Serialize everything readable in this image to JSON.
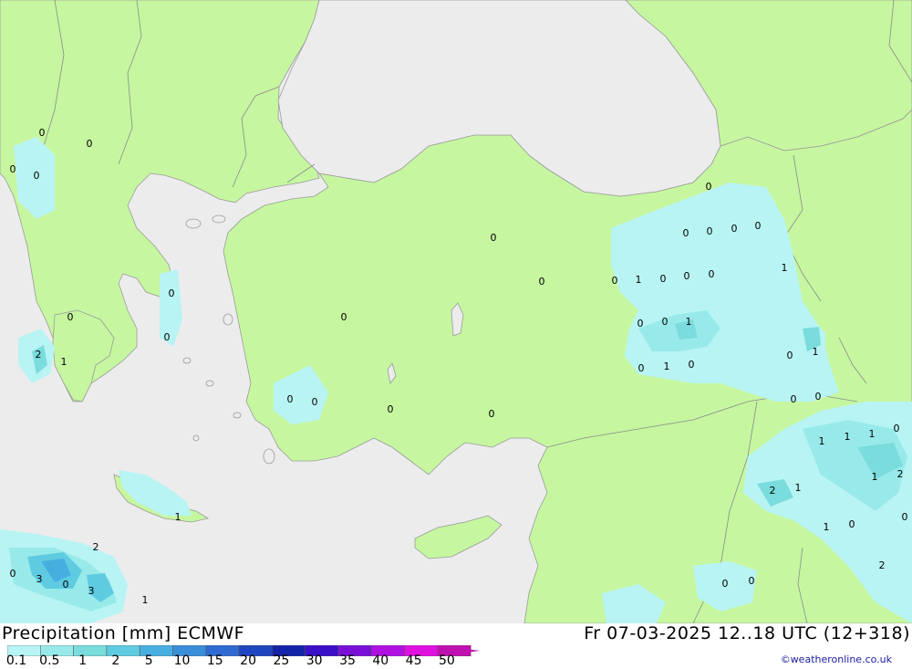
{
  "title": "Precipitation [mm] ECMWF",
  "valid_time": "Fr 07-03-2025 12..18 UTC (12+318)",
  "credit": "©weatheronline.co.uk",
  "colors": {
    "sea": "#ececec",
    "land": "#c6f7a0",
    "border": "#8a8a8a"
  },
  "legend": {
    "labels": [
      "0.1",
      "0.5",
      "1",
      "2",
      "5",
      "10",
      "15",
      "20",
      "25",
      "30",
      "35",
      "40",
      "45",
      "50"
    ],
    "colors": [
      "#b8f4f4",
      "#98eaea",
      "#7adcdc",
      "#5fcbe0",
      "#47afe0",
      "#3a8fd8",
      "#2f6bd0",
      "#2045c0",
      "#1424a8",
      "#3c10c8",
      "#7a10d8",
      "#b010e0",
      "#e010e0",
      "#c010b0"
    ]
  },
  "values": [
    "0",
    "0",
    "0",
    "0",
    "0",
    "0",
    "0",
    "0",
    "0",
    "0",
    "0",
    "0",
    "0",
    "0",
    "0",
    "0",
    "0",
    "0",
    "0",
    "0",
    "0",
    "0",
    "0",
    "0",
    "0",
    "0",
    "0",
    "0",
    "0",
    "0",
    "0",
    "0",
    "0",
    "0",
    "0",
    "0",
    "0",
    "1",
    "1",
    "1",
    "1",
    "1",
    "1",
    "1",
    "1",
    "1",
    "1",
    "1",
    "1",
    "1",
    "1",
    "2",
    "2",
    "2",
    "2",
    "2",
    "3",
    "3"
  ]
}
